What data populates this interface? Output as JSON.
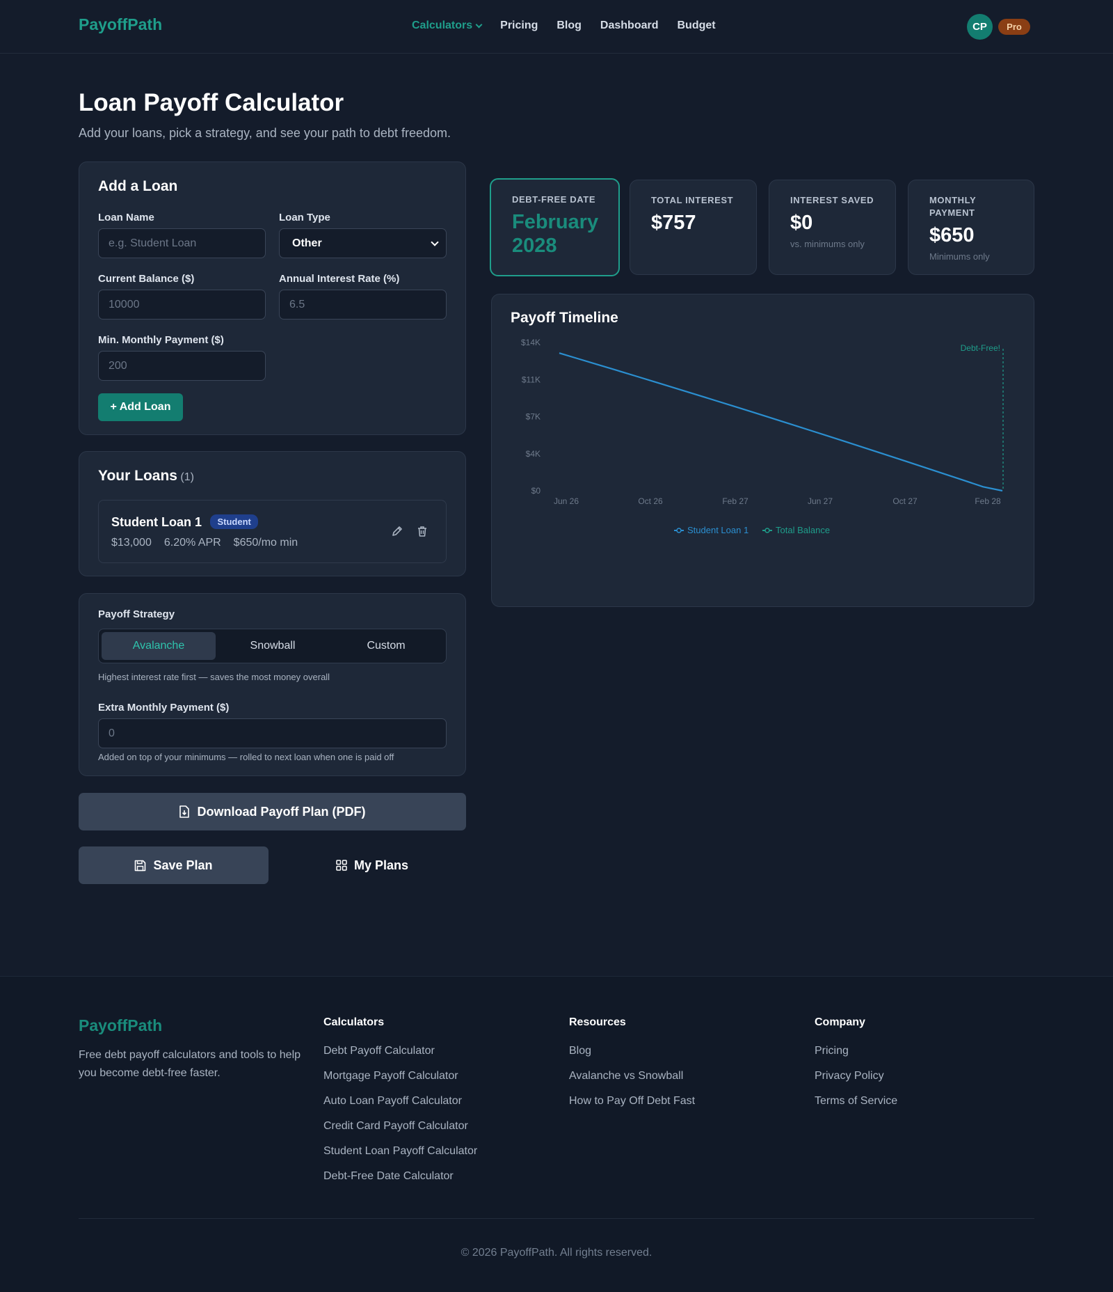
{
  "nav": {
    "logo": "PayoffPath",
    "links": [
      "Calculators",
      "Pricing",
      "Blog",
      "Dashboard",
      "Budget"
    ],
    "avatar_initials": "CP",
    "plan_badge": "Pro"
  },
  "header": {
    "title": "Loan Payoff Calculator",
    "subtitle": "Add your loans, pick a strategy, and see your path to debt freedom."
  },
  "add_loan": {
    "heading": "Add a Loan",
    "loan_name_label": "Loan Name",
    "loan_name_placeholder": "e.g. Student Loan",
    "loan_type_label": "Loan Type",
    "loan_type_value": "Other",
    "balance_label": "Current Balance ($)",
    "balance_placeholder": "10000",
    "rate_label": "Annual Interest Rate (%)",
    "rate_placeholder": "6.5",
    "min_payment_label": "Min. Monthly Payment ($)",
    "min_payment_placeholder": "200",
    "add_button": "+ Add Loan"
  },
  "your_loans": {
    "heading": "Your Loans",
    "count": "(1)",
    "items": [
      {
        "name": "Student Loan 1",
        "type": "Student",
        "balance": "$13,000",
        "apr": "6.20% APR",
        "min": "$650/mo min"
      }
    ]
  },
  "strategy": {
    "label": "Payoff Strategy",
    "options": [
      "Avalanche",
      "Snowball",
      "Custom"
    ],
    "selected": "Avalanche",
    "hint": "Highest interest rate first — saves the most money overall",
    "extra_label": "Extra Monthly Payment ($)",
    "extra_placeholder": "0",
    "extra_hint": "Added on top of your minimums — rolled to next loan when one is paid off"
  },
  "actions": {
    "download": "Download Payoff Plan (PDF)",
    "save": "Save Plan",
    "my_plans": "My Plans"
  },
  "stats": [
    {
      "label": "DEBT-FREE DATE",
      "value": "February 2028",
      "sub": ""
    },
    {
      "label": "TOTAL INTEREST",
      "value": "$757",
      "sub": ""
    },
    {
      "label": "INTEREST SAVED",
      "value": "$0",
      "sub": "vs. minimums only"
    },
    {
      "label": "MONTHLY PAYMENT",
      "value": "$650",
      "sub": "Minimums only"
    }
  ],
  "chart_data": {
    "type": "line",
    "title": "Payoff Timeline",
    "y_ticks": [
      "$14K",
      "$11K",
      "$7K",
      "$4K",
      "$0"
    ],
    "x_ticks": [
      "Jun 26",
      "Oct 26",
      "Feb 27",
      "Jun 27",
      "Oct 27",
      "Feb 28"
    ],
    "ylim": [
      0,
      14000
    ],
    "series": [
      {
        "name": "Student Loan 1",
        "color": "#2b8fd0",
        "x": [
          0,
          20
        ],
        "points_monthly": [
          13000,
          12458,
          11913,
          11365,
          10814,
          10260,
          9703,
          9143,
          8580,
          8014,
          7445,
          6873,
          6298,
          5719,
          5138,
          4553,
          3966,
          3375,
          2781,
          2184,
          1584,
          980,
          373,
          0
        ]
      },
      {
        "name": "Total Balance",
        "color": "#1f9e8b"
      }
    ],
    "annotation": "Debt-Free!",
    "grid": false,
    "legend": "bottom"
  },
  "footer": {
    "logo": "PayoffPath",
    "description": "Free debt payoff calculators and tools to help you become debt-free faster.",
    "columns": [
      {
        "title": "Calculators",
        "links": [
          "Debt Payoff Calculator",
          "Mortgage Payoff Calculator",
          "Auto Loan Payoff Calculator",
          "Credit Card Payoff Calculator",
          "Student Loan Payoff Calculator",
          "Debt-Free Date Calculator"
        ]
      },
      {
        "title": "Resources",
        "links": [
          "Blog",
          "Avalanche vs Snowball",
          "How to Pay Off Debt Fast"
        ]
      },
      {
        "title": "Company",
        "links": [
          "Pricing",
          "Privacy Policy",
          "Terms of Service"
        ]
      }
    ],
    "copyright": "© 2026 PayoffPath. All rights reserved."
  }
}
